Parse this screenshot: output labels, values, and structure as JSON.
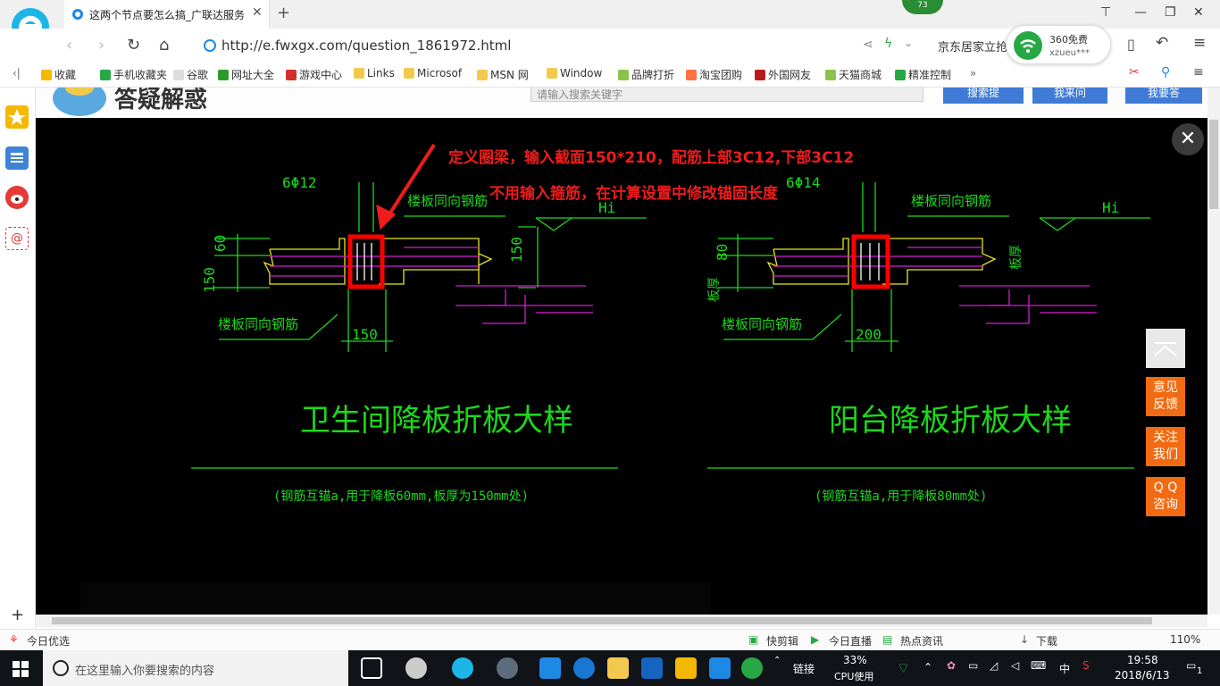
{
  "browser": {
    "tab_title": "这两个节点要怎么搞_广联达服务",
    "tab_close": "✕",
    "new_tab": "+",
    "badge_count": "73",
    "url": "http://e.fwxgx.com/question_1861972.html",
    "side_link": "京东居家立抢",
    "wifi": {
      "title": "360免费",
      "user": "xzueu***"
    }
  },
  "bookmarks": [
    "收藏",
    "手机收藏夹",
    "谷歌",
    "网址大全",
    "游戏中心",
    "Links",
    "Microsof",
    "MSN 网",
    "Window",
    "品牌打折",
    "淘宝团购",
    "外国网友",
    "天猫商城",
    "精准控制"
  ],
  "page": {
    "header_logo_text": "答疑解惑",
    "search_placeholder": "请输入搜索关键字",
    "header_buttons": [
      "搜索提",
      "我来问",
      "我要答"
    ]
  },
  "annotation": {
    "line1": "定义圈梁，输入截面150*210，配筋上部3C12,下部3C12",
    "line2": "不用输入箍筋，在计算设置中修改锚固长度"
  },
  "drawing": {
    "left": {
      "rebar": "6Φ12",
      "hi": "Hi",
      "label_top": "楼板同向钢筋",
      "label_bottom": "楼板同向钢筋",
      "dim_60": "60",
      "dim_150_left": "150",
      "dim_150_right": "150",
      "dim_150_bottom": "150",
      "title": "卫生间降板折板大样",
      "subtitle": "(钢筋互锚a,用于降板60mm,板厚为150mm处)"
    },
    "right": {
      "rebar": "6Φ14",
      "hi": "Hi",
      "label_top": "楼板同向钢筋",
      "label_bottom": "楼板同向钢筋",
      "dim_80": "80",
      "dim_left": "板厚",
      "dim_right": "板厚",
      "dim_200": "200",
      "title": "阳台降板折板大样",
      "subtitle": "(钢筋互锚a,用于降板80mm处)"
    }
  },
  "float_buttons": [
    "意见\n反馈",
    "关注\n我们",
    "Q Q\n咨询"
  ],
  "close_label": "✕",
  "statusbar": {
    "left": "今日优选",
    "items": [
      "快剪辑",
      "今日直播",
      "热点资讯",
      "下载"
    ],
    "zoom": "110%"
  },
  "taskbar": {
    "search_placeholder": "在这里输入你要搜索的内容",
    "link_label": "链接",
    "cpu_percent": "33%",
    "cpu_label": "CPU使用",
    "ime": "中",
    "time": "19:58",
    "date": "2018/6/13",
    "notif_count": "1"
  },
  "colors": {
    "accent": "#f26b12",
    "cad_green": "#1cd81c",
    "cad_magenta": "#d21cd2",
    "cad_yellow": "#e6e61c",
    "annotation_red": "#ee1c1c",
    "highlight_red": "#ff0000"
  }
}
